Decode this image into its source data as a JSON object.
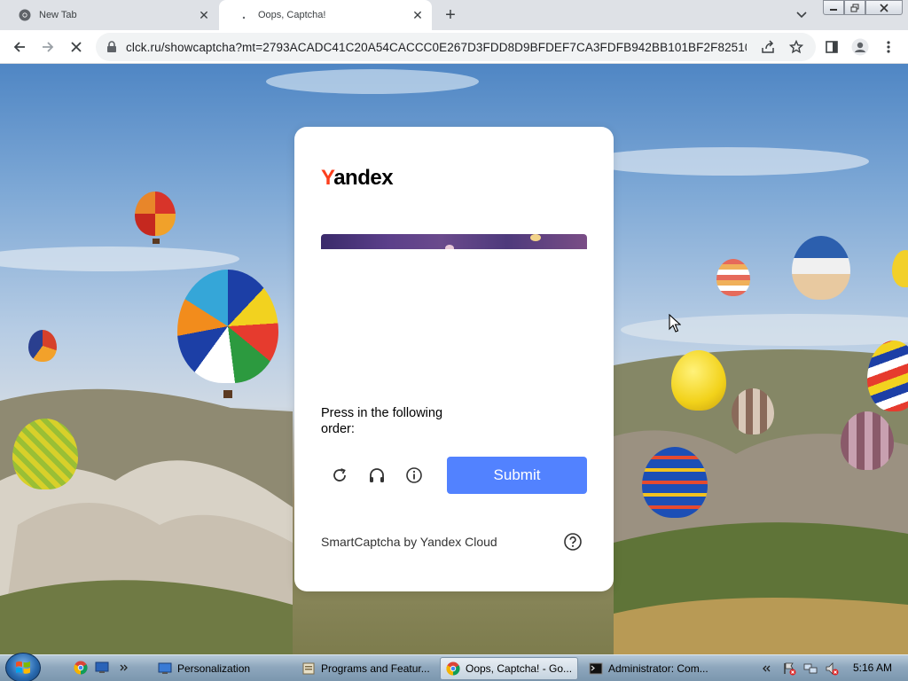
{
  "browser": {
    "tabs": [
      {
        "title": "New Tab",
        "active": false
      },
      {
        "title": "Oops, Captcha!",
        "active": true
      }
    ],
    "address": "clck.ru/showcaptcha?mt=2793ACADC41C20A54CACCC0E267D3FDD8D9BFDEF7CA3FDFB942BB101BF2F8251063..."
  },
  "captcha": {
    "logo_first": "Y",
    "logo_rest": "andex",
    "instruction": "Press in the following order:",
    "submit_label": "Submit",
    "footer": "SmartCaptcha by Yandex Cloud"
  },
  "taskbar": {
    "items": [
      {
        "label": "Personalization"
      },
      {
        "label": "Programs and Featur..."
      },
      {
        "label": "Oops, Captcha! - Go..."
      },
      {
        "label": "Administrator: Com..."
      }
    ],
    "clock": "5:16 AM"
  },
  "colors": {
    "yandex_red": "#fc3f1d",
    "submit_blue": "#5282ff",
    "taskbar": "#8ea7bd"
  }
}
